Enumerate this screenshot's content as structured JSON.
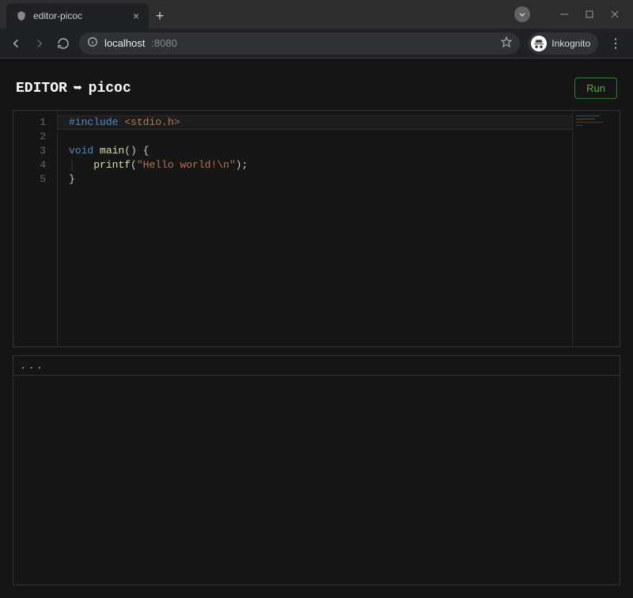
{
  "browser": {
    "tab_title": "editor-picoc",
    "url_host": "localhost",
    "url_port": ":8080",
    "profile_label": "Inkognito"
  },
  "header": {
    "title_prefix": "EDITOR",
    "title_target": "picoc",
    "run_label": "Run"
  },
  "editor": {
    "lines": [
      {
        "n": "1"
      },
      {
        "n": "2"
      },
      {
        "n": "3"
      },
      {
        "n": "4"
      },
      {
        "n": "5"
      }
    ],
    "code": {
      "l1_include": "#include",
      "l1_header": " <stdio.h>",
      "l3_kw1": "void",
      "l3_fn": " main",
      "l3_rest": "() {",
      "l4_indent": "    ",
      "l4_fn": "printf",
      "l4_open": "(",
      "l4_str": "\"Hello world!\\n\"",
      "l4_close": ");",
      "l5": "}"
    }
  },
  "output": {
    "header": "..."
  }
}
